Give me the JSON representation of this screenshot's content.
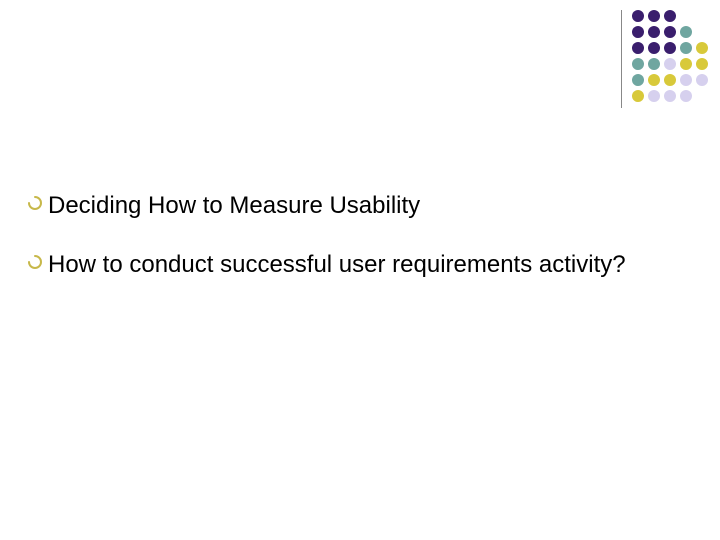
{
  "bullets": [
    {
      "text": "Deciding How to Measure Usability"
    },
    {
      "text": "How to conduct successful user requirements activity?"
    }
  ],
  "colors": {
    "bullet_arc": "#c7b84a",
    "dot_purple": "#3a1e6d",
    "dot_yellow": "#d8c93a",
    "dot_teal": "#6fa6a0",
    "dot_lav": "#d6d0ee"
  },
  "dot_grid": [
    [
      "dot_purple",
      "dot_purple",
      "dot_purple",
      "",
      ""
    ],
    [
      "dot_purple",
      "dot_purple",
      "dot_purple",
      "dot_teal",
      ""
    ],
    [
      "dot_purple",
      "dot_purple",
      "dot_purple",
      "dot_teal",
      "dot_yellow"
    ],
    [
      "dot_teal",
      "dot_teal",
      "dot_lav",
      "dot_yellow",
      "dot_yellow"
    ],
    [
      "dot_teal",
      "dot_yellow",
      "dot_yellow",
      "dot_lav",
      "dot_lav"
    ],
    [
      "dot_yellow",
      "dot_lav",
      "dot_lav",
      "dot_lav",
      ""
    ]
  ]
}
